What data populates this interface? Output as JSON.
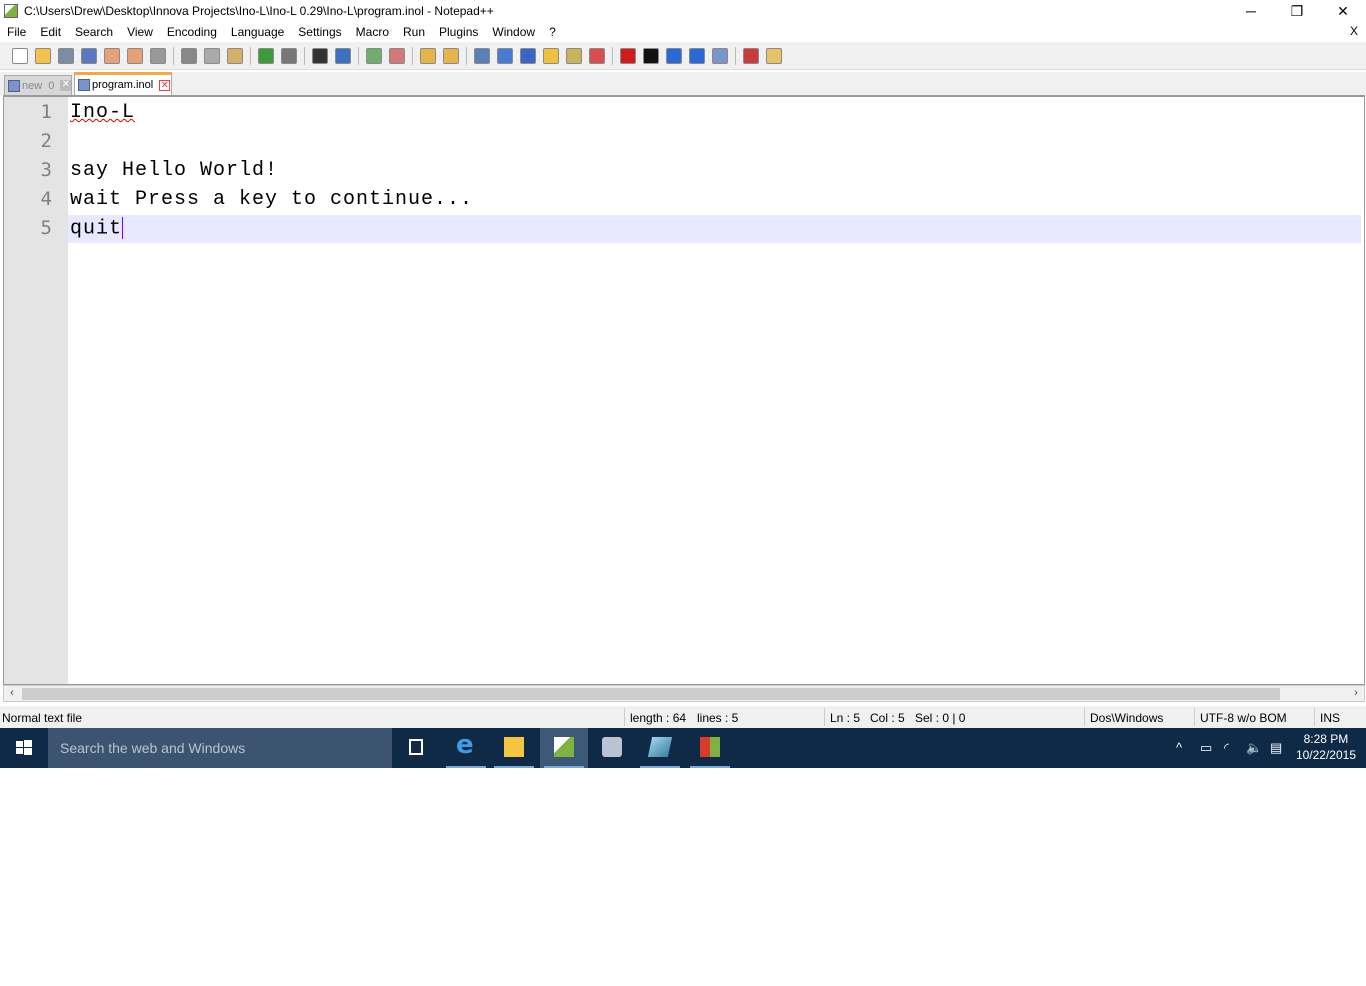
{
  "window": {
    "title": "C:\\Users\\Drew\\Desktop\\Innova Projects\\Ino-L\\Ino-L 0.29\\Ino-L\\program.inol - Notepad++",
    "minimize": "─",
    "maximize": "❐",
    "close": "✕"
  },
  "menu": [
    "File",
    "Edit",
    "Search",
    "View",
    "Encoding",
    "Language",
    "Settings",
    "Macro",
    "Run",
    "Plugins",
    "Window",
    "?"
  ],
  "menu_close": "X",
  "toolbar": [
    {
      "name": "new-file",
      "color": "#ffffff"
    },
    {
      "name": "open-file",
      "color": "#f2c14e"
    },
    {
      "name": "save",
      "color": "#7d8ca3"
    },
    {
      "name": "save-all",
      "color": "#5a78c0"
    },
    {
      "name": "close",
      "color": "#e8a07a"
    },
    {
      "name": "close-all",
      "color": "#e8a07a"
    },
    {
      "name": "print",
      "color": "#999999"
    },
    "|",
    {
      "name": "cut",
      "color": "#888888"
    },
    {
      "name": "copy",
      "color": "#aaaaaa"
    },
    {
      "name": "paste",
      "color": "#d6b06a"
    },
    "|",
    {
      "name": "undo",
      "color": "#3d9b3d"
    },
    {
      "name": "redo",
      "color": "#777777"
    },
    "|",
    {
      "name": "find",
      "color": "#333333"
    },
    {
      "name": "replace",
      "color": "#3d6fc0"
    },
    "|",
    {
      "name": "zoom-in",
      "color": "#6fae6f"
    },
    {
      "name": "zoom-out",
      "color": "#d27a7a"
    },
    "|",
    {
      "name": "sync-vertical",
      "color": "#e6b64d"
    },
    {
      "name": "sync-horizontal",
      "color": "#e6b64d"
    },
    "|",
    {
      "name": "word-wrap",
      "color": "#5b7fb8"
    },
    {
      "name": "show-all-chars",
      "color": "#4a7ad1"
    },
    {
      "name": "indent-guide",
      "color": "#3c64c8"
    },
    {
      "name": "user-language",
      "color": "#f0c040"
    },
    {
      "name": "doc-map",
      "color": "#c8b45a"
    },
    {
      "name": "function-list",
      "color": "#d65050"
    },
    "|",
    {
      "name": "record-macro",
      "color": "#d11c1c"
    },
    {
      "name": "stop-record",
      "color": "#111111"
    },
    {
      "name": "play-macro",
      "color": "#2b6ad6"
    },
    {
      "name": "run-macro-multiple",
      "color": "#2b6ad6"
    },
    {
      "name": "save-macro",
      "color": "#7896c8"
    },
    "|",
    {
      "name": "spell-check",
      "color": "#c83c3c"
    },
    {
      "name": "folder-as-workspace",
      "color": "#e6c36a"
    }
  ],
  "tabs": [
    {
      "label": "new  0",
      "close": "✕"
    },
    {
      "label": "program.inol",
      "close": "✕"
    }
  ],
  "editor": {
    "lines": [
      "Ino-L",
      "",
      "say Hello World!",
      "wait Press a key to continue...",
      "quit"
    ],
    "current_line": 5
  },
  "scroll": {
    "left": "‹",
    "right": "›"
  },
  "status": {
    "type": "Normal text file",
    "length": "length : 64",
    "lines": "lines : 5",
    "ln": "Ln : 5",
    "col": "Col : 5",
    "sel": "Sel : 0 | 0",
    "eol": "Dos\\Windows",
    "encoding": "UTF-8 w/o BOM",
    "mode": "INS"
  },
  "taskbar": {
    "search_placeholder": "Search the web and Windows",
    "time": "8:28 PM",
    "date": "10/22/2015"
  }
}
